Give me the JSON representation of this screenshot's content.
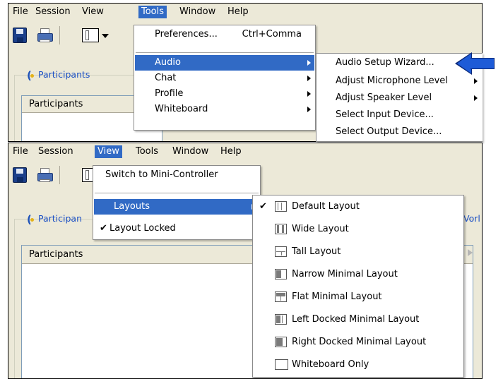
{
  "top": {
    "menubar": [
      "File",
      "Session",
      "View",
      "Tools",
      "Window",
      "Help"
    ],
    "active_menu": "Tools",
    "participants_tab": "Participants",
    "list_header": "Participants",
    "tools_menu": {
      "preferences": "Preferences...",
      "preferences_shortcut": "Ctrl+Comma",
      "items": [
        "Audio",
        "Chat",
        "Profile",
        "Whiteboard"
      ],
      "highlighted": "Audio"
    },
    "audio_submenu": [
      "Audio Setup Wizard...",
      "Adjust Microphone Level",
      "Adjust Speaker Level",
      "Select Input Device...",
      "Select Output Device..."
    ]
  },
  "bottom": {
    "menubar": [
      "File",
      "Session",
      "View",
      "Tools",
      "Window",
      "Help"
    ],
    "active_menu": "View",
    "participants_tab": "Participan",
    "right_tab_fragment": "Vorl",
    "list_header": "Participants",
    "view_menu": {
      "switch": "Switch to Mini-Controller",
      "layouts": "Layouts",
      "layout_locked": "Layout Locked",
      "layout_locked_checked": true
    },
    "layouts_submenu": [
      "Default Layout",
      "Wide Layout",
      "Tall Layout",
      "Narrow Minimal Layout",
      "Flat Minimal Layout",
      "Left Docked Minimal Layout",
      "Right Docked Minimal Layout",
      "Whiteboard Only"
    ],
    "layouts_checked": "Default Layout"
  },
  "colors": {
    "highlight": "#316ac5",
    "arrow": "#1e5bd7",
    "window_bg": "#ece9d8"
  },
  "icons": {
    "toolbar": [
      "save-icon",
      "print-icon",
      "layout-icon",
      "chevron-down-icon"
    ],
    "pointer": "arrow-left-icon"
  }
}
